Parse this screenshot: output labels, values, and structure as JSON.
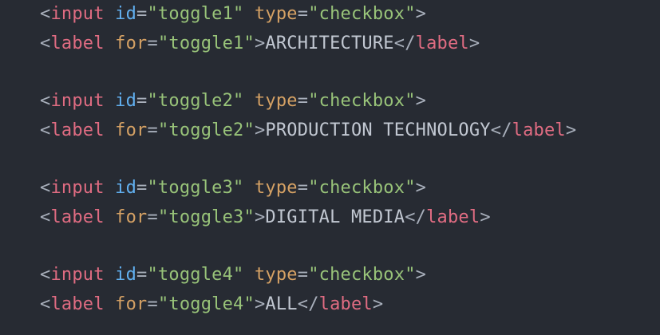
{
  "colors": {
    "background": "#272b33",
    "punctuation": "#a9b0bc",
    "tag": "#e06c82",
    "attr_id": "#61afef",
    "attr": "#d5a164",
    "string": "#98c379",
    "text": "#c2c8d2"
  },
  "code": {
    "lt": "<",
    "gt": ">",
    "close_lt": "</",
    "eq": "=",
    "input_tag": "input",
    "label_tag": "label",
    "id_attr": "id",
    "type_attr": "type",
    "for_attr": "for",
    "type_value": "\"checkbox\"",
    "blocks": [
      {
        "id_value": "\"toggle1\"",
        "label_text": "ARCHITECTURE"
      },
      {
        "id_value": "\"toggle2\"",
        "label_text": "PRODUCTION TECHNOLOGY"
      },
      {
        "id_value": "\"toggle3\"",
        "label_text": "DIGITAL MEDIA"
      },
      {
        "id_value": "\"toggle4\"",
        "label_text": "ALL"
      }
    ]
  }
}
